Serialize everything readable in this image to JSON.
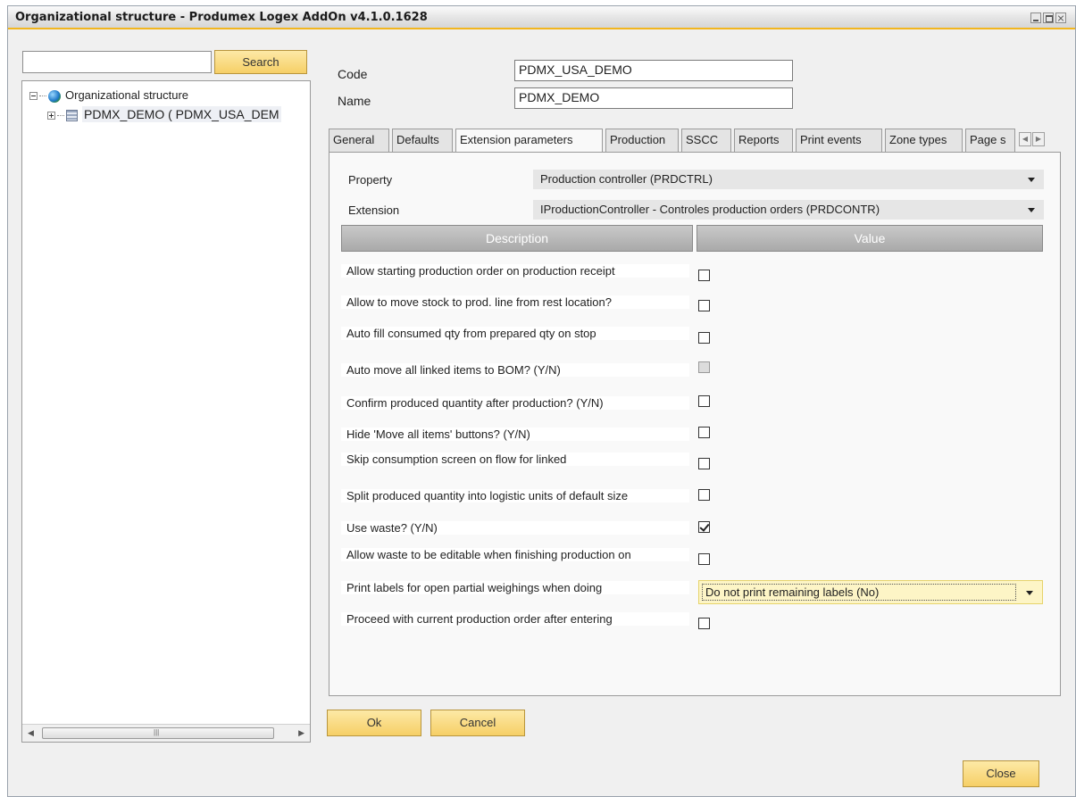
{
  "window": {
    "title": "Organizational structure - Produmex Logex AddOn v4.1.0.1628"
  },
  "search": {
    "value": "",
    "button_label": "Search"
  },
  "tree": {
    "root_label": "Organizational structure",
    "child_label": "PDMX_DEMO ( PDMX_USA_DEM"
  },
  "form": {
    "code_label": "Code",
    "code_value": "PDMX_USA_DEMO",
    "name_label": "Name",
    "name_value": "PDMX_DEMO"
  },
  "tabs": [
    {
      "label": "General"
    },
    {
      "label": "Defaults"
    },
    {
      "label": "Extension parameters"
    },
    {
      "label": "Production"
    },
    {
      "label": "SSCC"
    },
    {
      "label": "Reports"
    },
    {
      "label": "Print events"
    },
    {
      "label": "Zone types"
    },
    {
      "label": "Page s"
    }
  ],
  "active_tab": "Extension parameters",
  "extension": {
    "property_label": "Property",
    "property_value": "Production controller (PRDCTRL)",
    "extension_label": "Extension",
    "extension_value": "IProductionController - Controles production orders (PRDCONTR)"
  },
  "grid": {
    "columns": [
      "Description",
      "Value"
    ],
    "rows": [
      {
        "description": "Allow starting production order on production receipt",
        "type": "checkbox",
        "checked": false,
        "enabled": true
      },
      {
        "description": "Allow to move stock to prod. line from rest location?",
        "type": "checkbox",
        "checked": false,
        "enabled": true
      },
      {
        "description": "Auto fill consumed qty from prepared qty on stop",
        "type": "checkbox",
        "checked": false,
        "enabled": true
      },
      {
        "description": "Auto move all linked items to BOM? (Y/N)",
        "type": "checkbox",
        "checked": false,
        "enabled": false
      },
      {
        "description": "Confirm produced quantity after production? (Y/N)",
        "type": "checkbox",
        "checked": false,
        "enabled": true
      },
      {
        "description": "Hide 'Move all items' buttons? (Y/N)",
        "type": "checkbox",
        "checked": false,
        "enabled": true
      },
      {
        "description": "Skip consumption screen on flow for linked",
        "type": "checkbox",
        "checked": false,
        "enabled": true
      },
      {
        "description": "Split produced quantity into logistic units of default size",
        "type": "checkbox",
        "checked": false,
        "enabled": true
      },
      {
        "description": "Use waste? (Y/N)",
        "type": "checkbox",
        "checked": true,
        "enabled": true
      },
      {
        "description": "Allow waste to be editable when finishing production on",
        "type": "checkbox",
        "checked": false,
        "enabled": true
      },
      {
        "description": "Print labels for open partial weighings when doing",
        "type": "select",
        "value": "Do not print remaining labels (No)"
      },
      {
        "description": "Proceed with current production order after entering",
        "type": "checkbox",
        "checked": false,
        "enabled": true
      }
    ]
  },
  "buttons": {
    "ok": "Ok",
    "cancel": "Cancel",
    "close": "Close"
  },
  "colors": {
    "accent": "#f2b61e",
    "button_fill": "#f6cf66",
    "grid_header": "#b4b4b4",
    "selected_value_bg": "#fdf5c6"
  }
}
